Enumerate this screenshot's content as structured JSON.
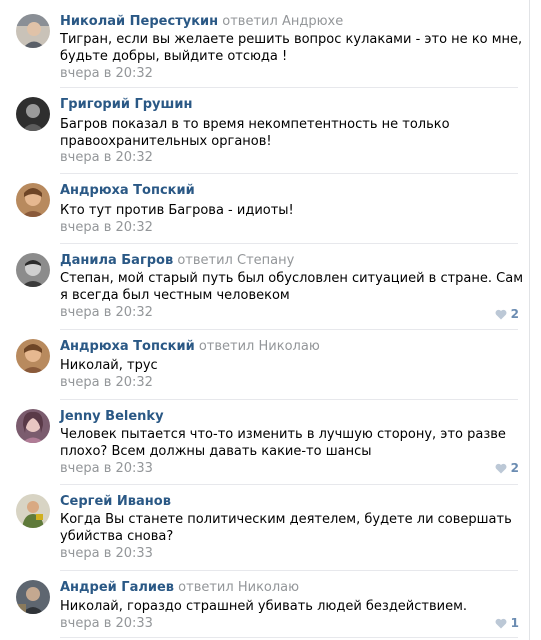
{
  "reply_word": "ответил",
  "comments": [
    {
      "author": "Николай Перестукин",
      "reply_to": "Андрюхе",
      "text": "Тигран, если вы желаете решить вопрос кулаками - это не ко мне, будьте добры, выйдите отсюда !",
      "date": "вчера в 20:32",
      "likes": ""
    },
    {
      "author": "Григорий Грушин",
      "reply_to": "",
      "text": "Багров показал в то время некомпетентность не только правоохранительных органов!",
      "date": "вчера в 20:32",
      "likes": ""
    },
    {
      "author": "Андрюха Топский",
      "reply_to": "",
      "text": "Кто тут против Багрова - идиоты!",
      "date": "вчера в 20:32",
      "likes": ""
    },
    {
      "author": "Данила Багров",
      "reply_to": "Степану",
      "text": "Степан, мой старый путь был обусловлен ситуацией в стране. Сам я всегда был честным человеком",
      "date": "вчера в 20:32",
      "likes": "2"
    },
    {
      "author": "Андрюха Топский",
      "reply_to": "Николаю",
      "text": "Николай, трус",
      "date": "вчера в 20:32",
      "likes": ""
    },
    {
      "author": "Jenny Belenky",
      "reply_to": "",
      "text": "Человек пытается что-то изменить в лучшую сторону, это разве плохо? Всем должны давать какие-то шансы",
      "date": "вчера в 20:33",
      "likes": "2"
    },
    {
      "author": "Сергей Иванов",
      "reply_to": "",
      "text": "Когда Вы станете политическим деятелем, будете ли совершать убийства снова?",
      "date": "вчера в 20:33",
      "likes": ""
    },
    {
      "author": "Андрей Галиев",
      "reply_to": "Николаю",
      "text": "Николай, гораздо страшней убивать людей бездействием.",
      "date": "вчера в 20:33",
      "likes": "1"
    }
  ],
  "colors": {
    "author_link": "#2a5885",
    "meta_gray": "#939699",
    "like_blue": "#6b8cb2",
    "separator": "#e7e8ec"
  },
  "icons": {
    "avatar": "avatar-photo",
    "like": "heart-icon"
  }
}
